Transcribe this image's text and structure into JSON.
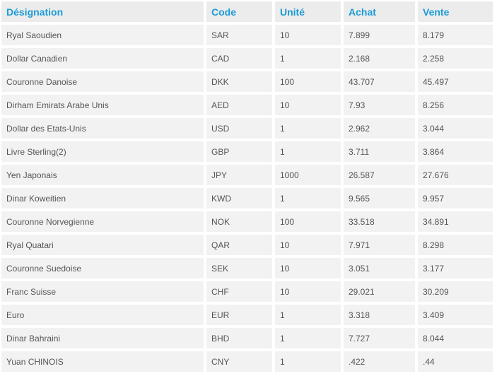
{
  "table": {
    "headers": [
      "Désignation",
      "Code",
      "Unité",
      "Achat",
      "Vente"
    ],
    "rows": [
      [
        "Ryal Saoudien",
        "SAR",
        "10",
        "7.899",
        "8.179"
      ],
      [
        "Dollar Canadien",
        "CAD",
        "1",
        "2.168",
        "2.258"
      ],
      [
        "Couronne Danoise",
        "DKK",
        "100",
        "43.707",
        "45.497"
      ],
      [
        "Dirham Emirats Arabe Unis",
        "AED",
        "10",
        "7.93",
        "8.256"
      ],
      [
        "Dollar des Etats-Unis",
        "USD",
        "1",
        "2.962",
        "3.044"
      ],
      [
        "Livre Sterling(2)",
        "GBP",
        "1",
        "3.711",
        "3.864"
      ],
      [
        "Yen Japonais",
        "JPY",
        "1000",
        "26.587",
        "27.676"
      ],
      [
        "Dinar Koweitien",
        "KWD",
        "1",
        "9.565",
        "9.957"
      ],
      [
        "Couronne Norvegienne",
        "NOK",
        "100",
        "33.518",
        "34.891"
      ],
      [
        "Ryal Quatari",
        "QAR",
        "10",
        "7.971",
        "8.298"
      ],
      [
        "Couronne Suedoise",
        "SEK",
        "10",
        "3.051",
        "3.177"
      ],
      [
        "Franc Suisse",
        "CHF",
        "10",
        "29.021",
        "30.209"
      ],
      [
        "Euro",
        "EUR",
        "1",
        "3.318",
        "3.409"
      ],
      [
        "Dinar Bahraini",
        "BHD",
        "1",
        "7.727",
        "8.044"
      ],
      [
        "Yuan CHINOIS",
        "CNY",
        "1",
        ".422",
        ".44"
      ]
    ]
  },
  "colors": {
    "header_text": "#1a9bd7",
    "header_bg": "#ececec",
    "cell_bg": "#f2f2f2",
    "cell_text": "#555555"
  }
}
